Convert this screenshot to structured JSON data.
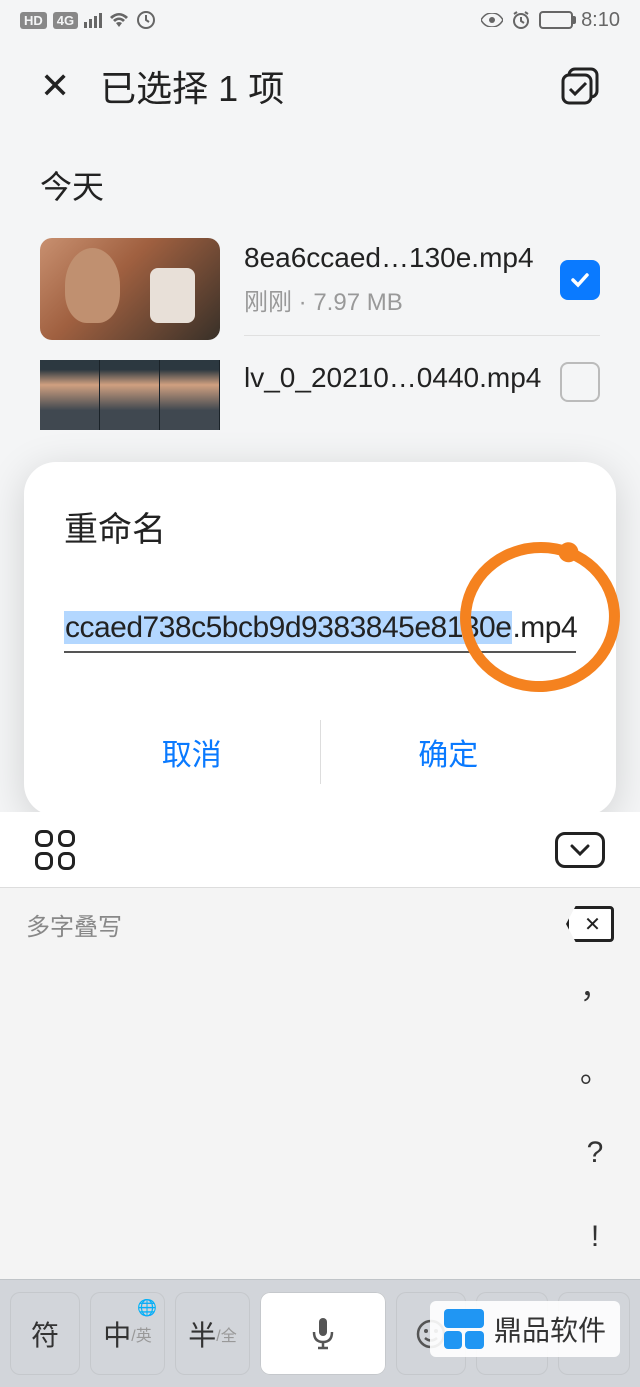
{
  "status": {
    "hd": "HD",
    "net": "4G",
    "time": "8:10"
  },
  "header": {
    "title": "已选择 1 项"
  },
  "section": "今天",
  "files": [
    {
      "name": "8ea6ccaed…130e.mp4",
      "meta": "刚刚 · 7.97 MB",
      "checked": true
    },
    {
      "name": "lv_0_20210…0440.mp4",
      "meta": "",
      "checked": false
    }
  ],
  "dialog": {
    "title": "重命名",
    "value_sel": "ccaed738c5bcb9d9383845e8130e",
    "value_ext": ".mp4",
    "cancel": "取消",
    "confirm": "确定"
  },
  "keyboard": {
    "suggestion": "多字叠写",
    "puncts": [
      "，",
      "。",
      "?",
      "!"
    ],
    "sym": "符",
    "zh": "中",
    "zh_sub": "/英",
    "half": "半",
    "half_sub": "/全"
  },
  "watermark": "鼎品软件"
}
